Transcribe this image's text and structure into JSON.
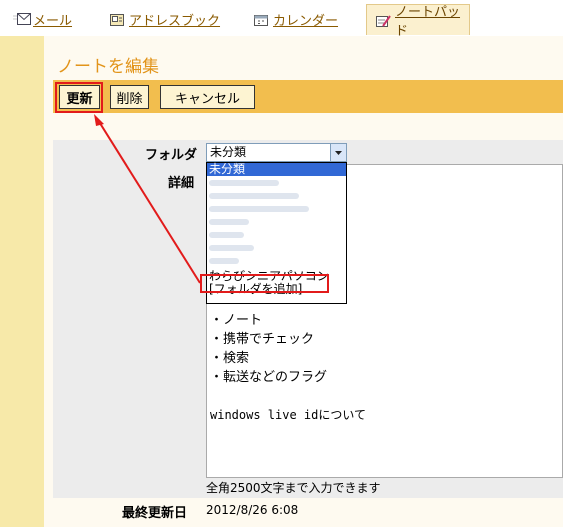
{
  "tabs": [
    {
      "label": "メール",
      "icon": "mail-icon"
    },
    {
      "label": "アドレスブック",
      "icon": "address-book-icon"
    },
    {
      "label": "カレンダー",
      "icon": "calendar-icon"
    },
    {
      "label": "ノートパッド",
      "icon": "notepad-icon",
      "active": true
    }
  ],
  "page_title": "ノートを編集",
  "toolbar": {
    "update_label": "更新",
    "delete_label": "削除",
    "cancel_label": "キャンセル"
  },
  "form": {
    "folder_label": "フォルダ",
    "folder_selected": "未分類",
    "detail_label": "詳細",
    "folder_options": [
      "未分類",
      "わらびシニアパソコン",
      "[フォルダを追加]"
    ],
    "detail_lines": [
      "・ノート",
      "・携帯でチェック",
      "・検索",
      "・転送などのフラグ",
      "",
      "windows live idについて"
    ],
    "char_limit_hint": "全角2500文字まで入力できます",
    "last_updated_label": "最終更新日",
    "last_updated_value": "2012/8/26 6:08"
  },
  "colors": {
    "toolbar": "#f2be4e",
    "accent": "#e2941a",
    "highlight": "#e21b1b",
    "selected": "#3168d5"
  }
}
